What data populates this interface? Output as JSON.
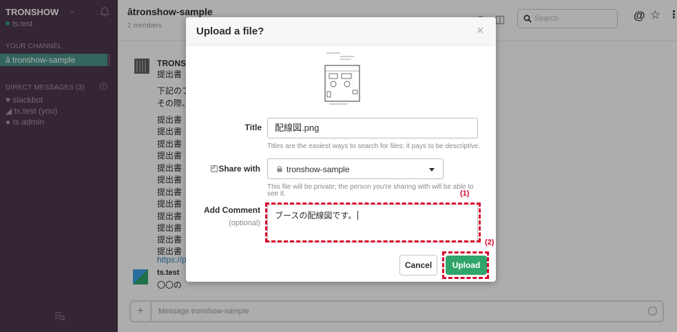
{
  "sidebar": {
    "team_name": "TRONSHOW",
    "team_caret": "⌄",
    "user": "ts.test",
    "your_channel_head": "YOUR CHANNEL",
    "active_channel": "â tronshow-sample",
    "dm_head": "DIRECT MESSAGES",
    "dm_count": "(3)",
    "dms": [
      "♥ slackbot",
      "◢ ts.test (you)",
      "● ts.admin"
    ]
  },
  "header": {
    "channel_title": "âtronshow-sample",
    "members": "2 members",
    "search_placeholder": "Search",
    "at": "@",
    "star": "☆",
    "more": "⋮"
  },
  "messages": {
    "sender1": "TRONSH",
    "lines": [
      "提出書",
      "下記のフ",
      "その際、",
      "提出書",
      "提出書",
      "提出書",
      "提出書",
      "提出書",
      "提出書",
      "提出書",
      "提出書",
      "提出書",
      "提出書",
      "提出書",
      "提出書"
    ],
    "link": "https://p",
    "sender2": "ts.test",
    "line2": "〇〇の"
  },
  "composer": {
    "plus": "+",
    "placeholder": "Message tronshow-sample"
  },
  "modal": {
    "title": "Upload a file?",
    "close": "×",
    "title_label": "Title",
    "title_value": "配線図.png",
    "title_hint": "Titles are the easiest ways to search for files: it pays to be descriptive.",
    "share_label": "Share with",
    "share_value": "tronshow-sample",
    "share_hint_1": "This file will be private; the person you're sharing with will be able to",
    "share_hint_2": "see it.",
    "comment_label": "Add Comment",
    "comment_sub": "(optional)",
    "comment_value": "ブースの配線図です。",
    "cancel": "Cancel",
    "upload": "Upload"
  },
  "annotations": {
    "label1": "(1)",
    "label2": "(2)"
  },
  "colors": {
    "sidebar_bg": "#4d394b",
    "active_channel": "#4c9689",
    "upload_green": "#2fa56b",
    "annotation_red": "#d7002a"
  }
}
